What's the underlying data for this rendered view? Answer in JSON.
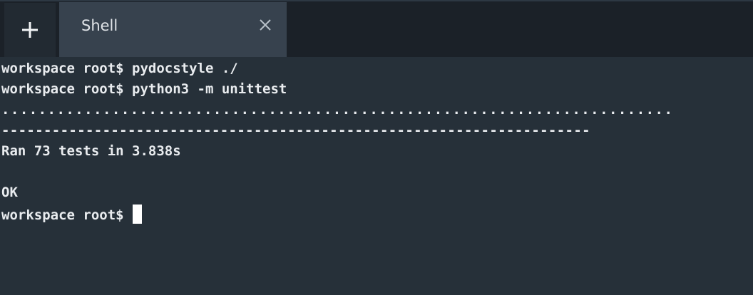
{
  "tabs": [
    {
      "label": "Shell",
      "active": true,
      "close_icon": "close-icon"
    }
  ],
  "new_tab_icon": "plus-icon",
  "colors": {
    "terminal_bg": "#263039",
    "tabbar_bg": "#1b2128",
    "active_tab_bg": "#37424e",
    "text": "#e9ecef"
  },
  "terminal": {
    "lines": [
      "workspace root$ pydocstyle ./",
      "workspace root$ python3 -m unittest",
      ".........................................................................",
      "----------------------------------------------------------------------",
      "Ran 73 tests in 3.838s",
      "",
      "OK"
    ],
    "prompt": "workspace root$"
  }
}
